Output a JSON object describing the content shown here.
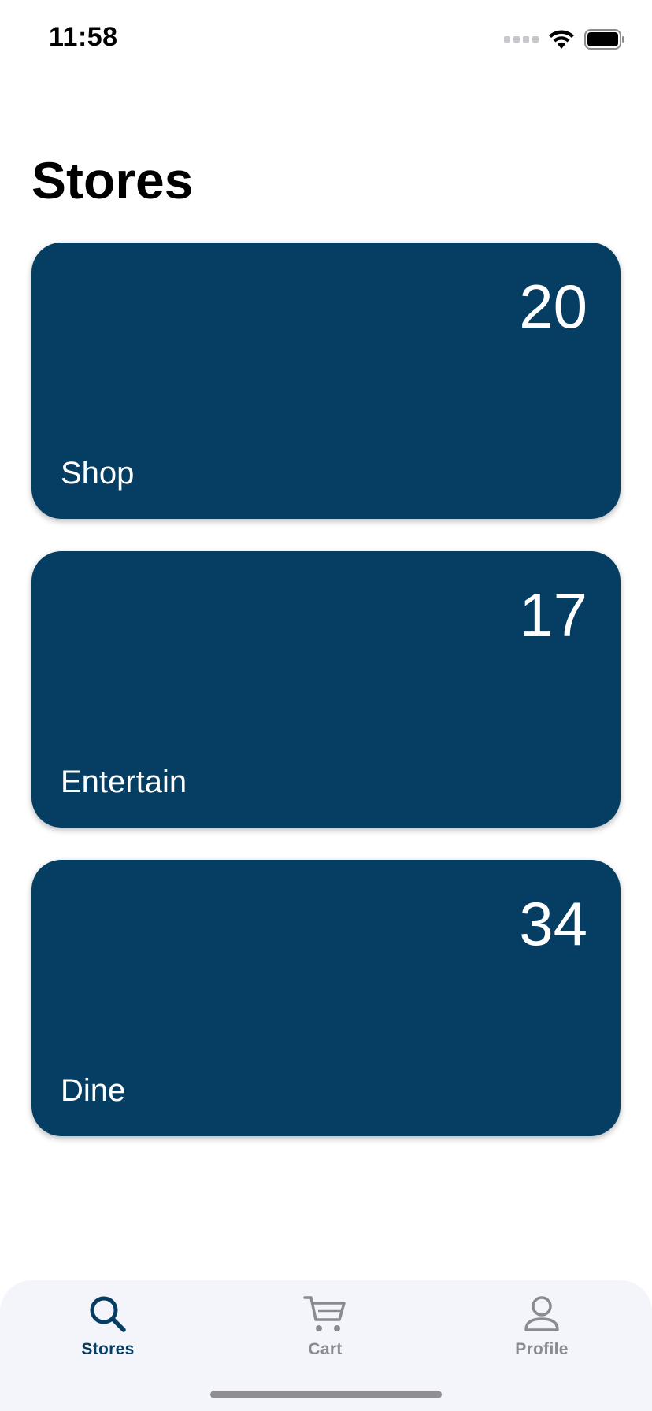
{
  "status_bar": {
    "time": "11:58",
    "icons": [
      "signal-dots-icon",
      "wifi-icon",
      "battery-icon"
    ]
  },
  "title": "Stores",
  "cards": [
    {
      "count": "20",
      "label": "Shop"
    },
    {
      "count": "17",
      "label": "Entertain"
    },
    {
      "count": "34",
      "label": "Dine"
    }
  ],
  "tabs": [
    {
      "label": "Stores",
      "icon": "search-icon",
      "active": true
    },
    {
      "label": "Cart",
      "icon": "cart-icon",
      "active": false
    },
    {
      "label": "Profile",
      "icon": "person-icon",
      "active": false
    }
  ],
  "colors": {
    "card_background": "#063e63",
    "active_tab": "#063e63",
    "inactive_tab": "#8a8a92",
    "tab_bar_background": "#f4f5fb"
  }
}
